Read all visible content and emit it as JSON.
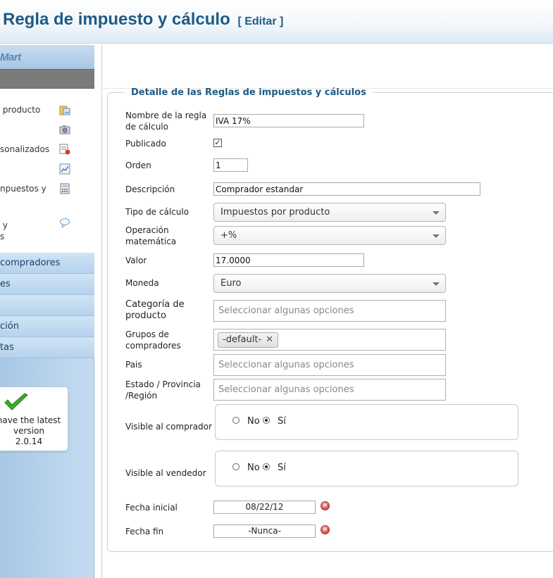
{
  "header": {
    "title": "Regla de impuesto y cálculo",
    "edit_label": "[ Editar ]"
  },
  "sidebar": {
    "logo_text": "Mart",
    "submenu": [
      {
        "label": " producto",
        "icon": "folder-image-icon"
      },
      {
        "label": "",
        "icon": "camera-icon"
      },
      {
        "label": "sonalizados",
        "icon": "custom-fields-icon"
      },
      {
        "label": "",
        "icon": "chart-icon"
      },
      {
        "label": "npuestos y",
        "icon": "calculator-icon"
      },
      {
        "label": " y\ns",
        "icon": "speech-bubble-icon"
      }
    ],
    "nav": [
      {
        "label": " compradores"
      },
      {
        "label": "es"
      },
      {
        "label": ""
      },
      {
        "label": "ción"
      },
      {
        "label": "tas"
      }
    ],
    "version_box": {
      "line1": "have the latest",
      "line2": "version",
      "line3": "2.0.14"
    }
  },
  "form": {
    "legend": "Detalle de las Reglas de impuestos y cálculos",
    "name_label": "Nombre de la regla\nde cálculo",
    "name_value": "IVA 17%",
    "published_label": "Publicado",
    "published_checked": true,
    "order_label": "Orden",
    "order_value": "1",
    "description_label": "Descripción",
    "description_value": "Comprador estandar",
    "calc_type_label": "Tipo de cálculo",
    "calc_type_value": "Impuestos por producto",
    "math_op_label": "Operación\nmatemática",
    "math_op_value": "+%",
    "value_label": "Valor",
    "value_value": "17.0000",
    "currency_label": "Moneda",
    "currency_value": "Euro",
    "category_label": "Categoría de\nproducto",
    "category_placeholder": "Seleccionar algunas opciones",
    "groups_label": "Grupos de\ncompradores",
    "groups_chip": "-default-",
    "country_label": "Pais",
    "country_placeholder": "Seleccionar algunas opciones",
    "state_label": "Estado / Provincia\n/Región",
    "state_placeholder": "Seleccionar algunas opciones",
    "visible_buyer_label": "Visible al comprador",
    "visible_seller_label": "Visible al vendedor",
    "radio_no": "No",
    "radio_yes": "Sí",
    "start_date_label": "Fecha inicial",
    "start_date_value": "08/22/12",
    "end_date_label": "Fecha fin",
    "end_date_value": "-Nunca-"
  }
}
